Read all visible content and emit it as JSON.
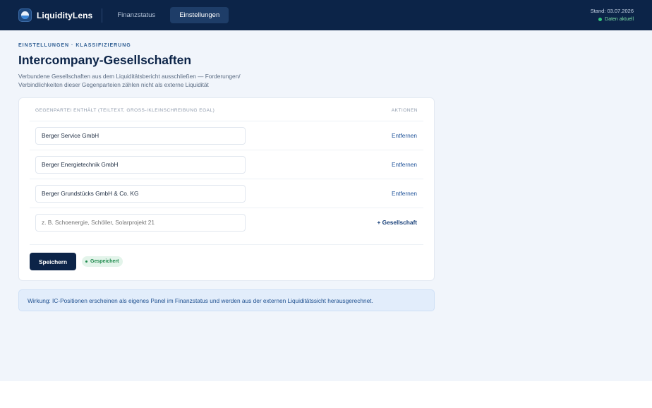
{
  "app": {
    "name": "LiquidityLens"
  },
  "nav": [
    {
      "label": "Finanzstatus",
      "active": false
    },
    {
      "label": "Einstellungen",
      "active": true
    }
  ],
  "status": {
    "date": "Stand: 03.07.2026",
    "live": "Daten aktuell"
  },
  "page": {
    "breadcrumb": "EINSTELLUNGEN · KLASSIFIZIERUNG",
    "title": "Intercompany-Gesellschaften",
    "subtitle": "Verbundene Gesellschaften aus dem Liquiditätsbericht ausschließen — Forderungen/ Verbindlichkeiten dieser Gegenparteien zählen nicht als externe Liquidität"
  },
  "table": {
    "col_counterparty": "GEGENPARTEI ENTHÄLT (TEILTEXT, GROSS-/KLEINSCHREIBUNG EGAL)",
    "col_actions": "AKTIONEN",
    "rows": [
      {
        "value": "Berger Service GmbH",
        "action": "Entfernen"
      },
      {
        "value": "Berger Energietechnik GmbH",
        "action": "Entfernen"
      },
      {
        "value": "Berger Grundstücks GmbH & Co. KG",
        "action": "Entfernen"
      }
    ],
    "new_row": {
      "placeholder": "z. B. Schoenergie, Schöller, Solarprojekt 21",
      "action": "+ Gesellschaft"
    }
  },
  "save": {
    "label": "Speichern",
    "status": "Gespeichert"
  },
  "notice": "Wirkung: IC-Positionen erscheinen als eigenes Panel im Finanzstatus und werden aus der externen Liquiditätssicht herausgerechnet.",
  "colors": {
    "navy": "#0c2448",
    "accent": "#1e5299",
    "success": "#1f8a4d",
    "background": "#f1f5fb"
  }
}
